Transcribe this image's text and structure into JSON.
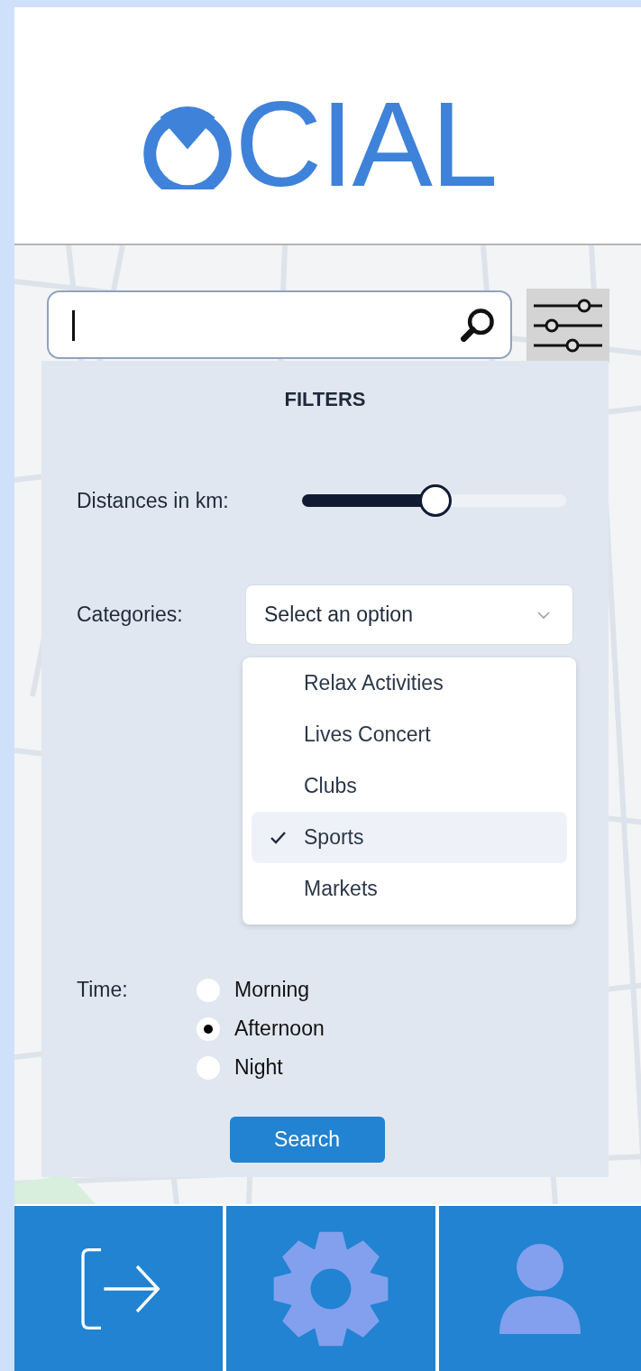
{
  "logo": {
    "text": "CIAL"
  },
  "filters": {
    "title": "FILTERS",
    "distance": {
      "label": "Distances in km:",
      "level": 0.5
    },
    "categories": {
      "label": "Categories:",
      "placeholder": "Select an option",
      "expanded": true,
      "options": [
        {
          "label": "Relax Activities",
          "selected": false
        },
        {
          "label": "Lives Concert",
          "selected": false
        },
        {
          "label": "Clubs",
          "selected": false
        },
        {
          "label": "Sports",
          "selected": true
        },
        {
          "label": "Markets",
          "selected": false
        }
      ]
    },
    "time": {
      "label": "Time:",
      "options": [
        {
          "label": "Morning",
          "selected": false
        },
        {
          "label": "Afternoon",
          "selected": true
        },
        {
          "label": "Night",
          "selected": false
        }
      ]
    },
    "search_button": "Search"
  },
  "nav": [
    {
      "kind": "logout"
    },
    {
      "kind": "settings"
    },
    {
      "kind": "profile"
    }
  ]
}
